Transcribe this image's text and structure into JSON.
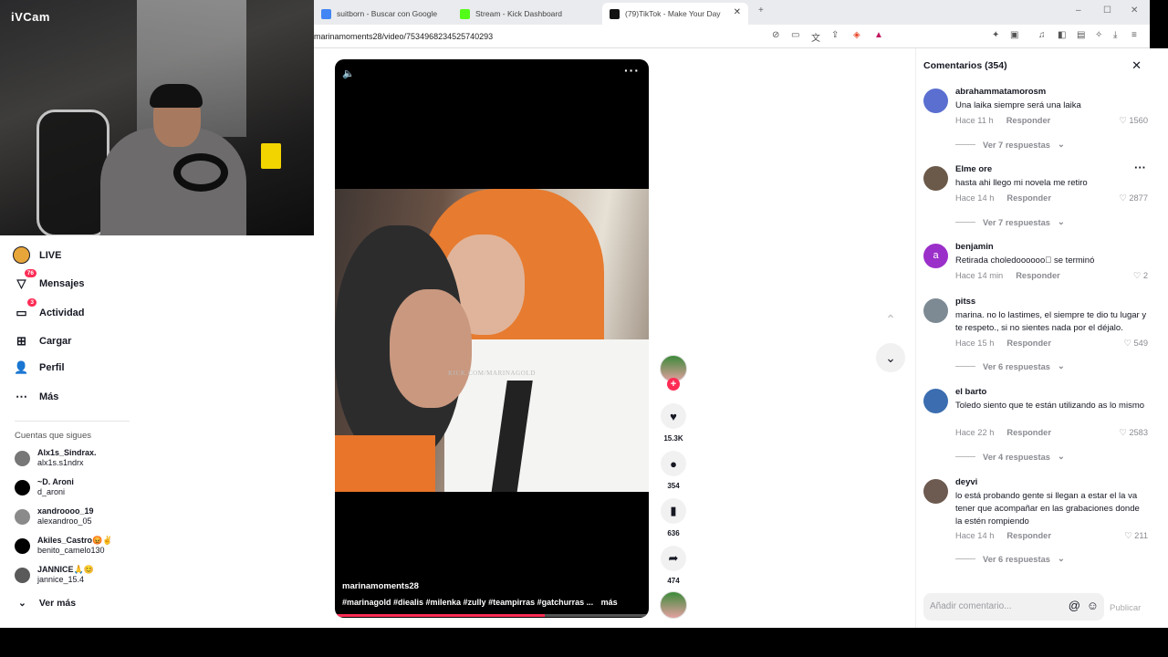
{
  "webcam": {
    "logo": "iVCam"
  },
  "browser": {
    "tabs": [
      {
        "label": "suitborn - Buscar con Google",
        "favicon_color": "#4285f4"
      },
      {
        "label": "Stream - Kick Dashboard",
        "favicon_color": "#53fc18"
      },
      {
        "label": "(79)TikTok - Make Your Day",
        "favicon_color": "#111111"
      }
    ],
    "new_tab": "+",
    "window_controls": [
      "–",
      "☐",
      "✕"
    ],
    "url": "marinamoments28/video/7534968234525740293"
  },
  "sidebar": {
    "items": [
      {
        "label": "LIVE",
        "icon": "live-icon",
        "badge": ""
      },
      {
        "label": "Mensajes",
        "icon": "messages-icon",
        "badge": "76"
      },
      {
        "label": "Actividad",
        "icon": "activity-icon",
        "badge": "3"
      },
      {
        "label": "Cargar",
        "icon": "upload-icon",
        "badge": ""
      },
      {
        "label": "Perfil",
        "icon": "profile-icon",
        "badge": ""
      },
      {
        "label": "Más",
        "icon": "more-icon",
        "badge": ""
      }
    ],
    "following_title": "Cuentas que sigues",
    "accounts": [
      {
        "name": "Alx1s_Sindrax.",
        "handle": "alx1s.s1ndrx"
      },
      {
        "name": "~D. Aroni",
        "handle": "d_aroni"
      },
      {
        "name": "xandroooo_19",
        "handle": "alexandroo_05"
      },
      {
        "name": "Akiles_Castro😡✌",
        "handle": "benito_camelo130"
      },
      {
        "name": "JANNICE🙏😊",
        "handle": "jannice_15.4"
      }
    ],
    "see_more": "Ver más"
  },
  "video": {
    "watermark": "KICK.COM/MARINAGOLD",
    "author": "marinamoments28",
    "tags": "#marinagold #diealis #milenka #zully #teampirras #gatchurras ...",
    "more": "más",
    "progress": 0.67,
    "accent": "#fe2c55"
  },
  "actions": {
    "likes": "15.3K",
    "comments": "354",
    "saves": "636",
    "shares": "474"
  },
  "comments": {
    "title": "Comentarios (354)",
    "reply_label": "Responder",
    "items": [
      {
        "user": "abrahammatamorosm",
        "text": "Una laika siempre será una laika",
        "time": "Hace 11 h",
        "likes": "1560",
        "replies": "Ver 7 respuestas",
        "avatar_color": "#5a6fd0"
      },
      {
        "user": "Elme ore",
        "text": "hasta ahi llego mi novela me retiro",
        "time": "Hace 14 h",
        "likes": "2877",
        "replies": "Ver 7 respuestas",
        "avatar_color": "#6b5a4a"
      },
      {
        "user": "benjamin",
        "text": "Retirada choledoooooo\u0000 se terminó",
        "time": "Hace 14 min",
        "likes": "2",
        "replies": "",
        "avatar_color": "#9b2fc9"
      },
      {
        "user": "pitss",
        "text": "marina. no lo lastimes, el siempre te dio tu lugar y te respeto., si no sientes nada por el déjalo.",
        "time": "Hace 15 h",
        "likes": "549",
        "replies": "Ver 6 respuestas",
        "avatar_color": "#7d8a94"
      },
      {
        "user": "el barto",
        "text": "Toledo siento que te están utilizando as lo mismo",
        "time": "Hace 22 h",
        "likes": "2583",
        "replies": "Ver 4 respuestas",
        "avatar_color": "#3b6db0"
      },
      {
        "user": "deyvi",
        "text": "lo está probando gente si llegan a estar el la va tener que acompañar en las grabaciones donde la estén rompiendo",
        "time": "Hace 14 h",
        "likes": "211",
        "replies": "Ver 6 respuestas",
        "avatar_color": "#6d5a50"
      }
    ],
    "input_placeholder": "Añadir comentario...",
    "publish": "Publicar"
  }
}
